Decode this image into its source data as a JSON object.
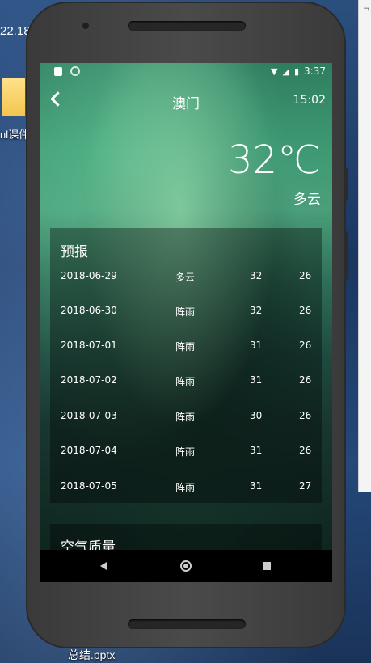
{
  "desktop": {
    "time_fragment": "22.18",
    "folder_label": "nl课件",
    "file_label": "总结.pptx"
  },
  "status_bar": {
    "time": "3:37",
    "icons": [
      "sim-card-icon",
      "sync-icon",
      "wifi-icon",
      "no-signal-icon",
      "battery-icon"
    ]
  },
  "header": {
    "city": "澳门",
    "update_time": "15:02"
  },
  "now": {
    "temperature": "32℃",
    "condition": "多云"
  },
  "forecast": {
    "title": "预报",
    "rows": [
      {
        "date": "2018-06-29",
        "weather": "多云",
        "max": "32",
        "min": "26"
      },
      {
        "date": "2018-06-30",
        "weather": "阵雨",
        "max": "32",
        "min": "26"
      },
      {
        "date": "2018-07-01",
        "weather": "阵雨",
        "max": "31",
        "min": "26"
      },
      {
        "date": "2018-07-02",
        "weather": "阵雨",
        "max": "31",
        "min": "26"
      },
      {
        "date": "2018-07-03",
        "weather": "阵雨",
        "max": "30",
        "min": "26"
      },
      {
        "date": "2018-07-04",
        "weather": "阵雨",
        "max": "31",
        "min": "26"
      },
      {
        "date": "2018-07-05",
        "weather": "阵雨",
        "max": "31",
        "min": "27"
      }
    ]
  },
  "aqi": {
    "title": "空气质量"
  },
  "nav_bar": {
    "buttons": [
      "back-icon",
      "home-icon",
      "recents-icon"
    ]
  }
}
